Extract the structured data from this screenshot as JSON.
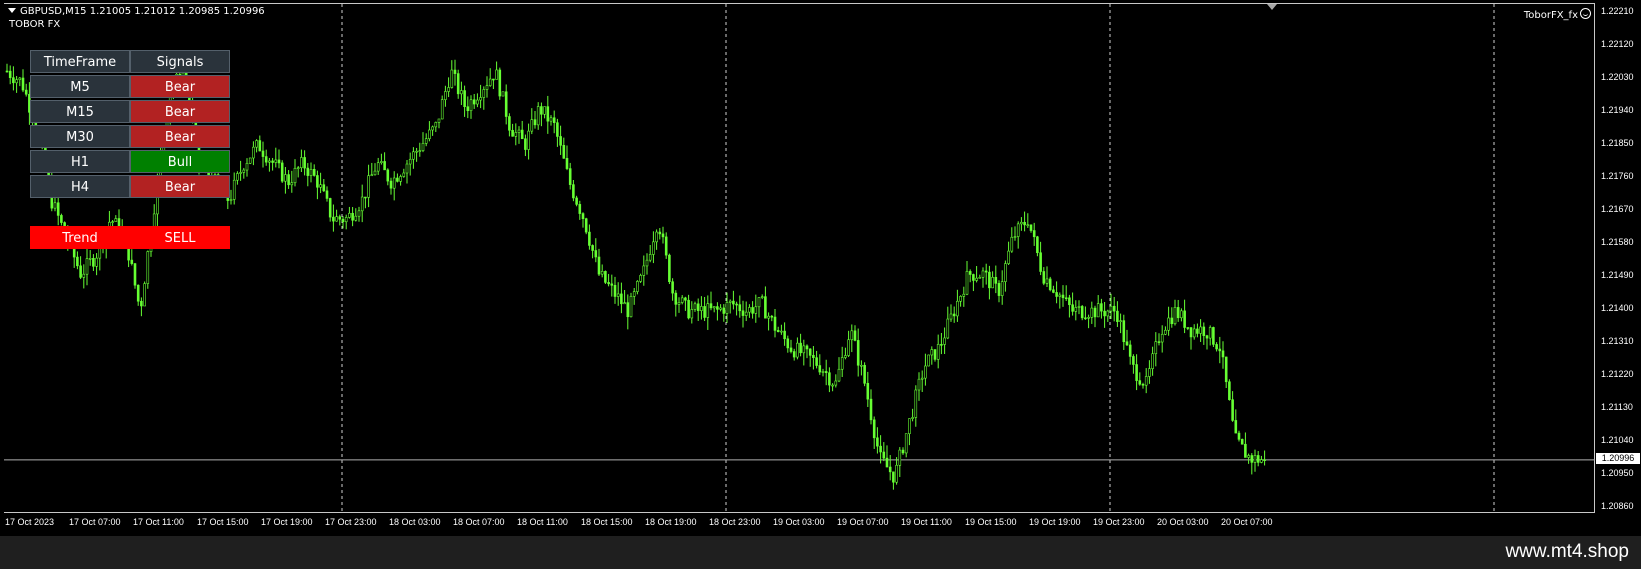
{
  "header": {
    "symbol_line": "GBPUSD,M15  1.21005 1.21012 1.20985 1.20996",
    "indicator_name": "TOBOR FX",
    "brand_tag": "ToborFX_fx"
  },
  "signals_table": {
    "headers": [
      "TimeFrame",
      "Signals"
    ],
    "rows": [
      {
        "tf": "M5",
        "signal": "Bear",
        "color": "#b22222"
      },
      {
        "tf": "M15",
        "signal": "Bear",
        "color": "#b22222"
      },
      {
        "tf": "M30",
        "signal": "Bear",
        "color": "#b22222"
      },
      {
        "tf": "H1",
        "signal": "Bull",
        "color": "#008000"
      },
      {
        "tf": "H4",
        "signal": "Bear",
        "color": "#b22222"
      }
    ],
    "trend_label": "Trend",
    "trend_value": "SELL",
    "trend_color": "#ff0000"
  },
  "chart_data": {
    "type": "candlestick",
    "symbol": "GBPUSD",
    "timeframe": "M15",
    "last_price": "1.20996",
    "candle_color": "#66ff33",
    "y_ticks": [
      "1.22210",
      "1.22120",
      "1.22030",
      "1.21940",
      "1.21850",
      "1.21760",
      "1.21670",
      "1.21580",
      "1.21490",
      "1.21400",
      "1.21310",
      "1.21220",
      "1.21130",
      "1.21040",
      "1.20950",
      "1.20860"
    ],
    "x_ticks": [
      "17 Oct 2023",
      "17 Oct 07:00",
      "17 Oct 11:00",
      "17 Oct 15:00",
      "17 Oct 19:00",
      "17 Oct 23:00",
      "18 Oct 03:00",
      "18 Oct 07:00",
      "18 Oct 11:00",
      "18 Oct 15:00",
      "18 Oct 19:00",
      "18 Oct 23:00",
      "19 Oct 03:00",
      "19 Oct 07:00",
      "19 Oct 11:00",
      "19 Oct 15:00",
      "19 Oct 19:00",
      "19 Oct 23:00",
      "20 Oct 03:00",
      "20 Oct 07:00"
    ],
    "ylim": [
      1.2086,
      1.2221
    ],
    "approx_close_path": [
      1.2205,
      1.2202,
      1.219,
      1.217,
      1.216,
      1.215,
      1.2155,
      1.2165,
      1.216,
      1.214,
      1.217,
      1.22,
      1.2205,
      1.218,
      1.2175,
      1.217,
      1.218,
      1.2185,
      1.218,
      1.2175,
      1.218,
      1.2175,
      1.2165,
      1.2165,
      1.217,
      1.218,
      1.2175,
      1.218,
      1.2185,
      1.219,
      1.2205,
      1.2195,
      1.22,
      1.2205,
      1.219,
      1.2185,
      1.2195,
      1.219,
      1.2175,
      1.2165,
      1.215,
      1.2145,
      1.214,
      1.215,
      1.2165,
      1.2145,
      1.214,
      1.214,
      1.214,
      1.2142,
      1.214,
      1.2142,
      1.2135,
      1.213,
      1.2128,
      1.2125,
      1.212,
      1.2135,
      1.212,
      1.21,
      1.2095,
      1.211,
      1.2125,
      1.213,
      1.214,
      1.215,
      1.215,
      1.2145,
      1.216,
      1.2165,
      1.215,
      1.2145,
      1.214,
      1.214,
      1.214,
      1.214,
      1.2125,
      1.212,
      1.2135,
      1.214,
      1.2135,
      1.2135,
      1.213,
      1.2105,
      1.21,
      1.20996
    ]
  },
  "watermark": "www.mt4.shop"
}
